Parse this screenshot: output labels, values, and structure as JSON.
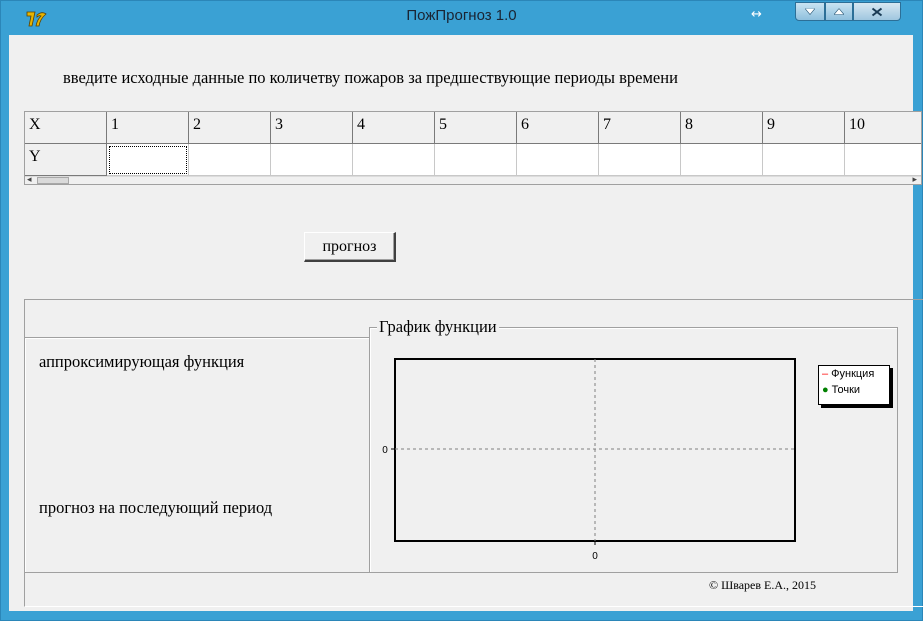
{
  "window": {
    "title": "ПожПрогноз 1.0",
    "resize_glyph": "↔",
    "colors": {
      "frame": "#3aa1d4",
      "client": "#f0f0f0"
    }
  },
  "input": {
    "prompt": "введите исходные данные по количетву пожаров за  предшествующие периоды времени",
    "grid": {
      "x_header": "X",
      "y_header": "Y",
      "x_values": [
        "1",
        "2",
        "3",
        "4",
        "5",
        "6",
        "7",
        "8",
        "9",
        "10"
      ],
      "y_values": [
        "",
        "",
        "",
        "",
        "",
        "",
        "",
        "",
        "",
        ""
      ]
    },
    "scroll_left": "◂",
    "scroll_right": "▸"
  },
  "forecast_button": "прогноз",
  "results": {
    "approx_label": "аппроксимирующая функция",
    "forecast_label": "прогноз на последующий период"
  },
  "chart_data": {
    "type": "line",
    "title": "График функции",
    "x": [],
    "y": [],
    "x_tick": "0",
    "y_tick": "0",
    "grid": true,
    "legend_position": "top-right",
    "series": [
      {
        "name": "Функция",
        "values": [],
        "color": "#ff0000"
      },
      {
        "name": "Точки",
        "values": [],
        "color": "#008000"
      }
    ]
  },
  "copyright": "© Шварев Е.А., 2015"
}
